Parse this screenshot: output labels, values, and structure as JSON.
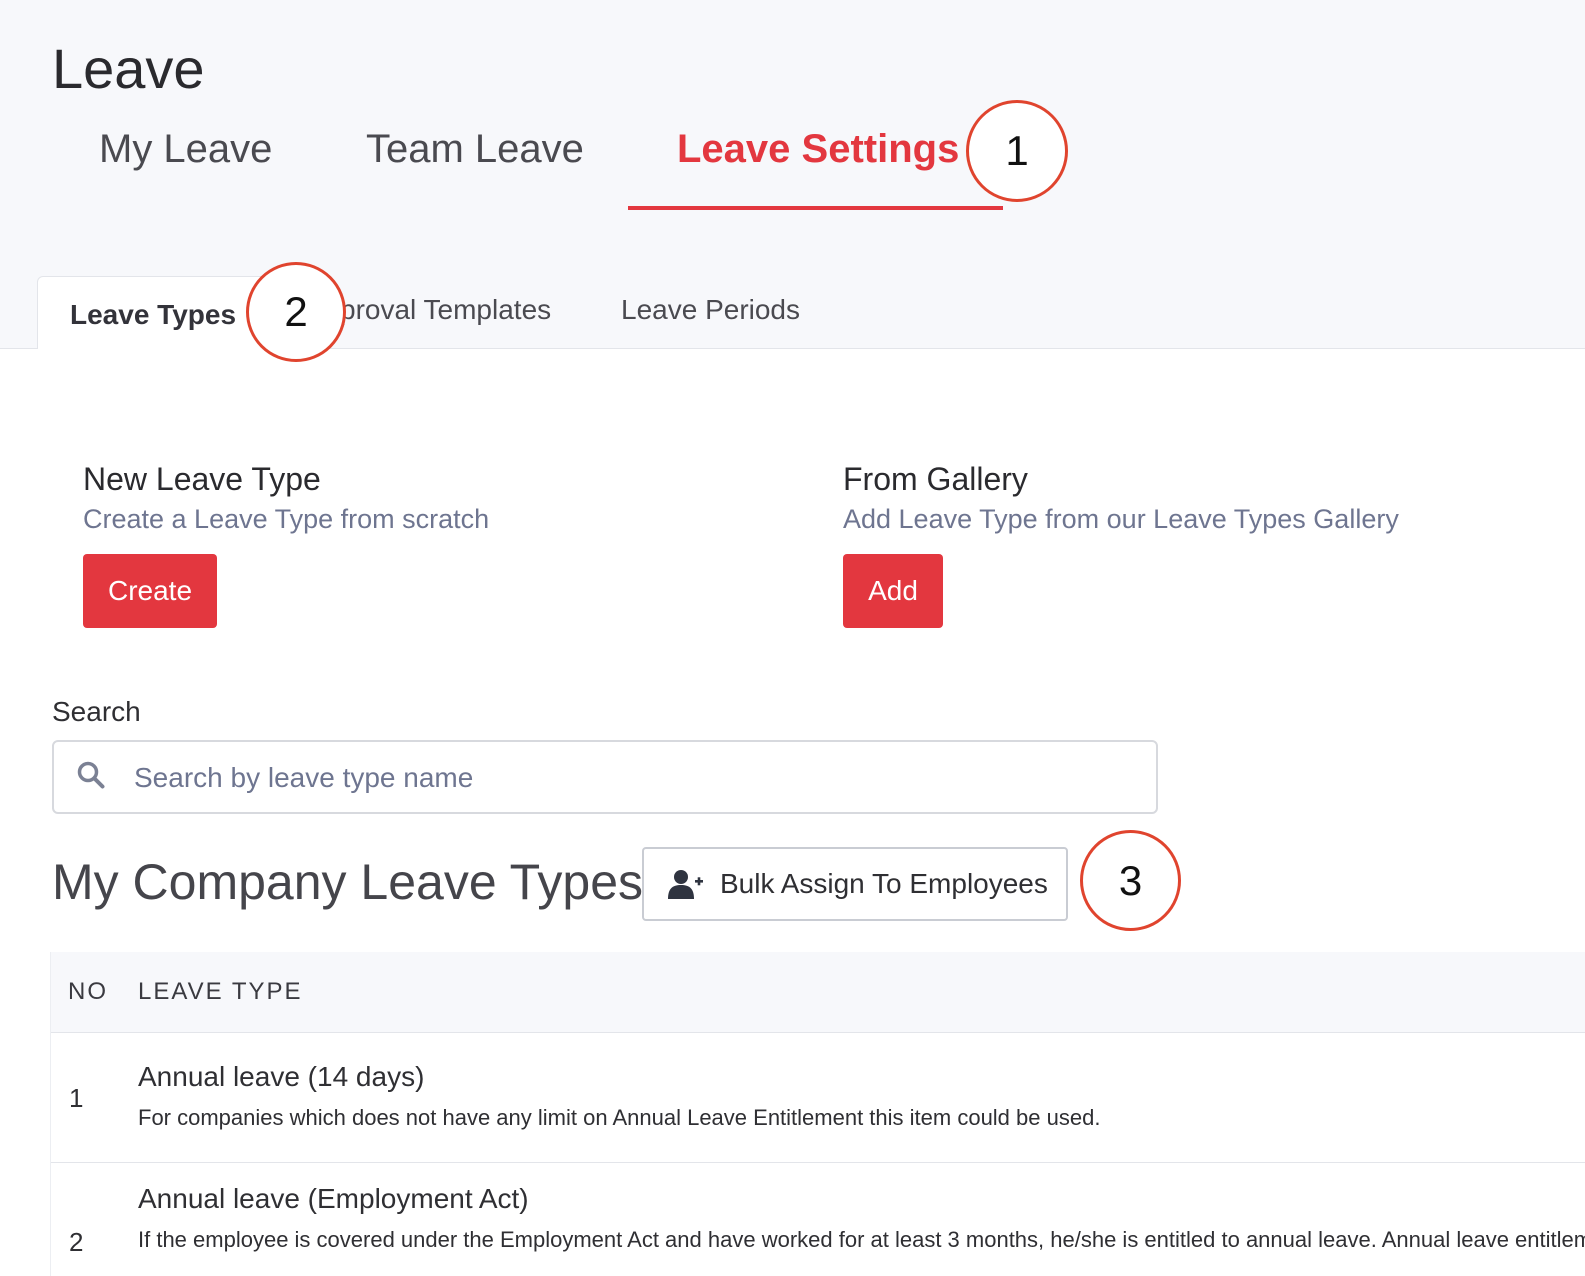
{
  "page": {
    "title": "Leave"
  },
  "main_tabs": [
    {
      "label": "My Leave",
      "active": false
    },
    {
      "label": "Team Leave",
      "active": false
    },
    {
      "label": "Leave Settings",
      "active": true
    }
  ],
  "sub_tabs": [
    {
      "label": "Leave Types",
      "active": true
    },
    {
      "label": "proval Templates",
      "active": false
    },
    {
      "label": "Leave Periods",
      "active": false
    }
  ],
  "annotations": [
    "1",
    "2",
    "3"
  ],
  "cards": {
    "new": {
      "title": "New Leave Type",
      "subtitle": "Create a Leave Type from scratch",
      "button": "Create"
    },
    "gallery": {
      "title": "From Gallery",
      "subtitle": "Add Leave Type from our Leave Types Gallery",
      "button": "Add"
    }
  },
  "search": {
    "label": "Search",
    "placeholder": "Search by leave type name",
    "value": ""
  },
  "section": {
    "title": "My Company Leave Types",
    "bulk_button": "Bulk Assign To Employees"
  },
  "table": {
    "columns": [
      "NO",
      "LEAVE TYPE"
    ],
    "rows": [
      {
        "no": "1",
        "name": "Annual leave (14 days)",
        "description": "For companies which does not have any limit on Annual Leave Entitlement this item could be used."
      },
      {
        "no": "2",
        "name": "Annual leave (Employment Act)",
        "description": "If the employee is covered under the Employment Act and have worked for at least 3 months, he/she is entitled to annual leave. Annual leave entitlement"
      }
    ]
  },
  "colors": {
    "accent": "#e3373f",
    "annotation": "#e0442e",
    "muted_text": "#6e7590",
    "header_bg": "#f7f8fb"
  }
}
